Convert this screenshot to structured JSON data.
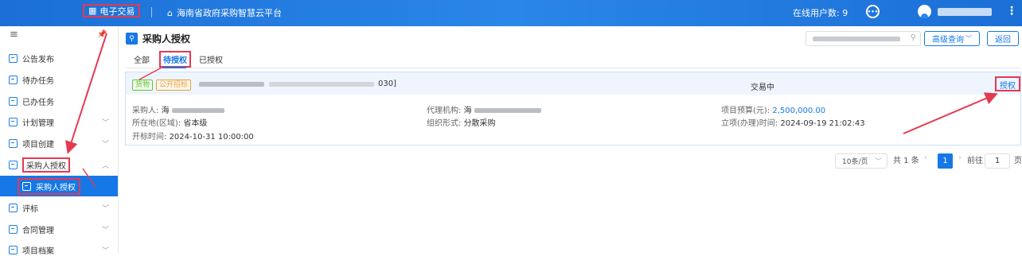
{
  "topbar": {
    "brand": "电子交易",
    "platform": "海南省政府采购智慧云平台",
    "online_users": "在线用户数: 9"
  },
  "sidebar": {
    "items": [
      {
        "label": "公告发布"
      },
      {
        "label": "待办任务"
      },
      {
        "label": "已办任务"
      },
      {
        "label": "计划管理"
      },
      {
        "label": "项目创建"
      },
      {
        "label": "采购人授权"
      },
      {
        "label": "采购人授权"
      },
      {
        "label": "评标"
      },
      {
        "label": "合同管理"
      },
      {
        "label": "项目档案"
      }
    ]
  },
  "page": {
    "title": "采购人授权",
    "advanced_search": "高级查询",
    "back": "返回"
  },
  "tabs": [
    "全部",
    "待授权",
    "已授权"
  ],
  "record": {
    "tag_goods": "货物",
    "tag_method": "公开招标",
    "code_suffix": "030]",
    "status": "交易中",
    "action": "授权",
    "purchaser_label": "采购人:",
    "purchaser_prefix": "海",
    "region_label": "所在地(区域):",
    "region_value": "省本级",
    "open_time_label": "开标时间:",
    "open_time_value": "2024-10-31 10:00:00",
    "agency_label": "代理机构:",
    "agency_prefix": "海",
    "org_form_label": "组织形式:",
    "org_form_value": "分散采购",
    "budget_label": "项目预算(元):",
    "budget_value": "2,500,000.00",
    "setup_time_label": "立项(办理)时间:",
    "setup_time_value": "2024-09-19 21:02:43"
  },
  "pagination": {
    "page_size": "10条/页",
    "total": "共 1 条",
    "current": "1",
    "goto_label": "前往",
    "goto_value": "1",
    "page_unit": "页"
  }
}
